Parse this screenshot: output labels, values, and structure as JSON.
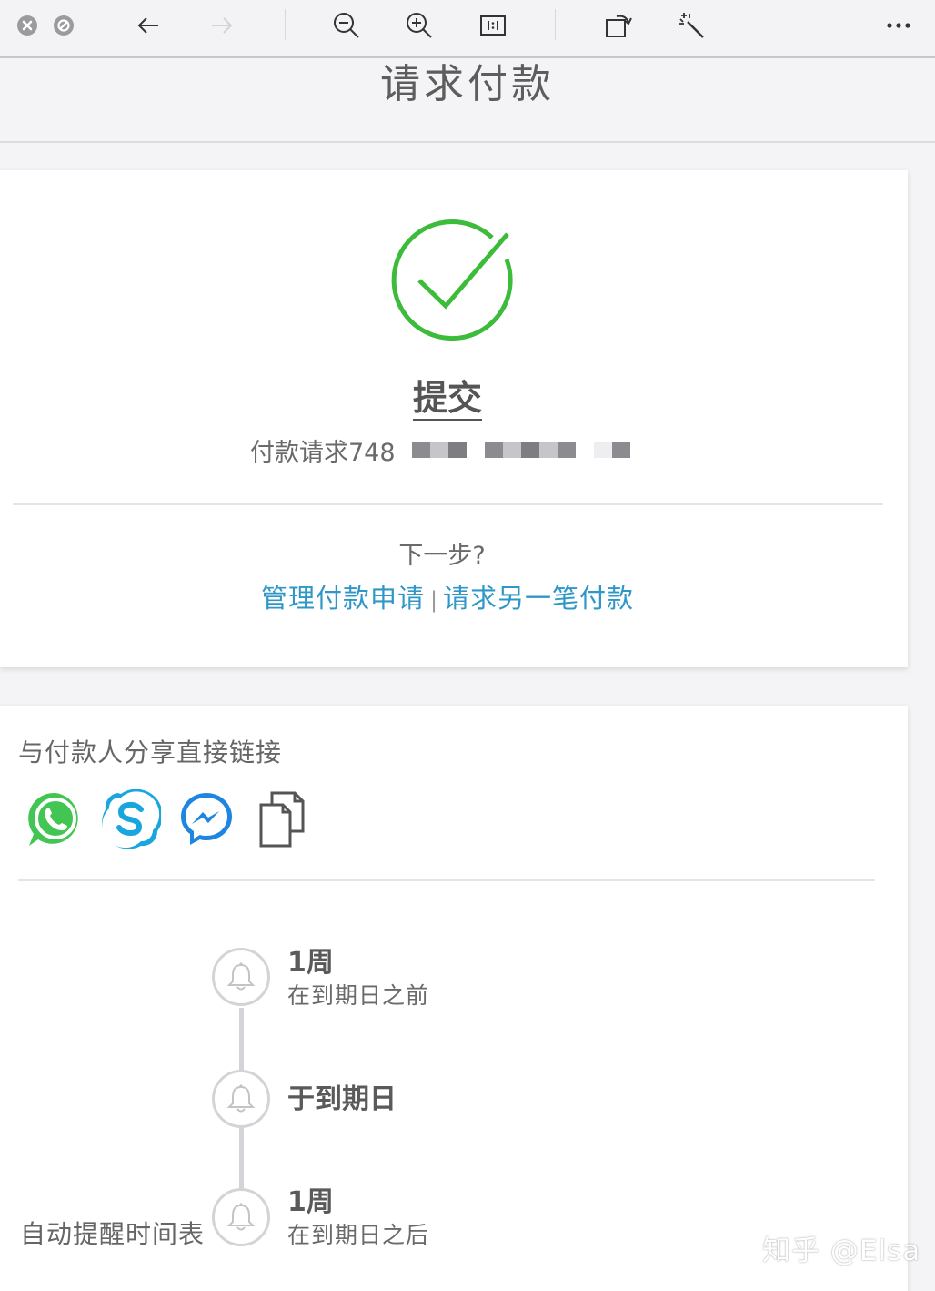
{
  "toolbar": {
    "buttons": [
      {
        "name": "close-tab-icon"
      },
      {
        "name": "stop-icon"
      },
      {
        "name": "back-arrow-icon"
      },
      {
        "name": "forward-arrow-icon"
      },
      {
        "name": "zoom-out-icon"
      },
      {
        "name": "zoom-in-icon"
      },
      {
        "name": "actual-size-icon"
      },
      {
        "name": "rotate-icon"
      },
      {
        "name": "enhance-wand-icon"
      },
      {
        "name": "more-icon"
      }
    ]
  },
  "header": {
    "title": "请求付款"
  },
  "status_card": {
    "title": "提交",
    "request_label": "付款请求748",
    "next_label": "下一步?",
    "links": {
      "manage": "管理付款申请",
      "separator": "|",
      "another": "请求另一笔付款"
    }
  },
  "share_card": {
    "title": "与付款人分享直接链接",
    "icons": [
      "whatsapp-icon",
      "skype-icon",
      "messenger-icon",
      "copy-icon"
    ]
  },
  "reminders": {
    "label": "自动提醒时间表",
    "items": [
      {
        "main": "1周",
        "sub": "在到期日之前"
      },
      {
        "main": "于到期日",
        "sub": ""
      },
      {
        "main": "1周",
        "sub": "在到期日之后"
      }
    ]
  },
  "watermark": "知乎 @Elsa",
  "colors": {
    "success": "#3dbb3a",
    "link": "#2f97c8",
    "whatsapp": "#43c553",
    "skype": "#19a6de",
    "messenger": "#1f86e0"
  }
}
